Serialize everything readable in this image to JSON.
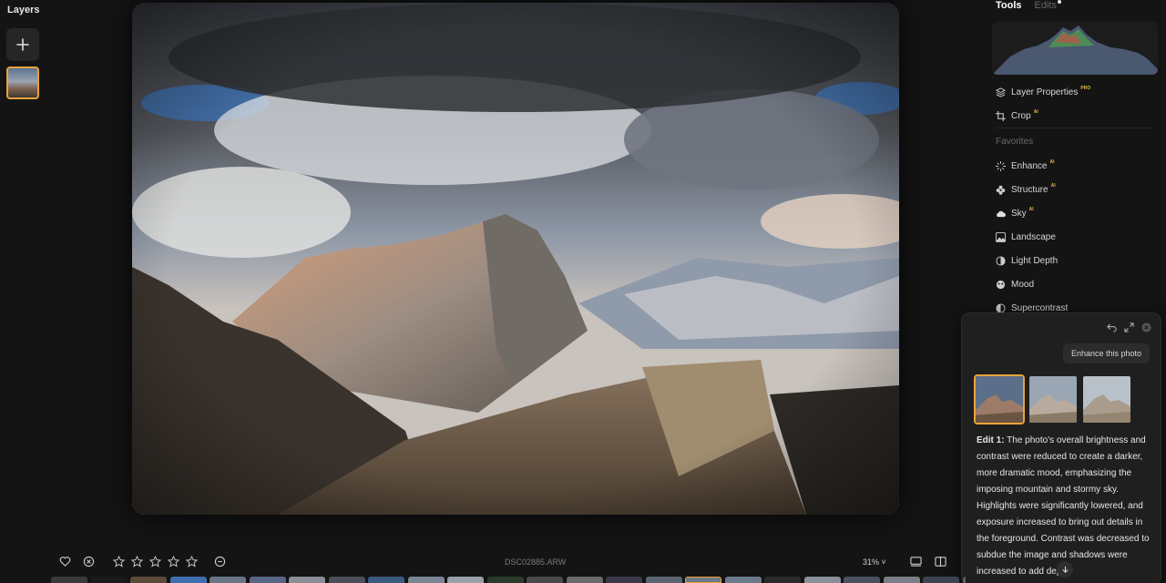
{
  "layers": {
    "title": "Layers"
  },
  "tools": {
    "tabs": {
      "tools": "Tools",
      "edits": "Edits"
    },
    "layer_properties": {
      "label": "Layer Properties",
      "badge": "PRO"
    },
    "crop": {
      "label": "Crop",
      "badge": "AI"
    },
    "favorites_label": "Favorites",
    "items": [
      {
        "label": "Enhance",
        "badge": "AI"
      },
      {
        "label": "Structure",
        "badge": "AI"
      },
      {
        "label": "Sky",
        "badge": "AI"
      },
      {
        "label": "Landscape",
        "badge": ""
      },
      {
        "label": "Light Depth",
        "badge": ""
      },
      {
        "label": "Mood",
        "badge": ""
      },
      {
        "label": "Supercontrast",
        "badge": ""
      }
    ]
  },
  "assistant": {
    "prompt": "Enhance this photo",
    "edit_heading": "Edit 1:",
    "edit_body": " The photo's overall brightness and contrast were reduced to create a darker, more dramatic mood, emphasizing the imposing mountain and stormy sky. Highlights were significantly lowered, and exposure increased to bring out details in the foreground. Contrast was decreased to subdue the image and shadows were increased to add depth.",
    "selected_variant": 1
  },
  "bottombar": {
    "filename": "DSC02885.ARW",
    "zoom": "31% ˅",
    "rating_stars": 5,
    "rating_value": 0
  },
  "colors": {
    "accent": "#e8a43a",
    "background": "#141414",
    "panel": "#1f1f1f"
  }
}
